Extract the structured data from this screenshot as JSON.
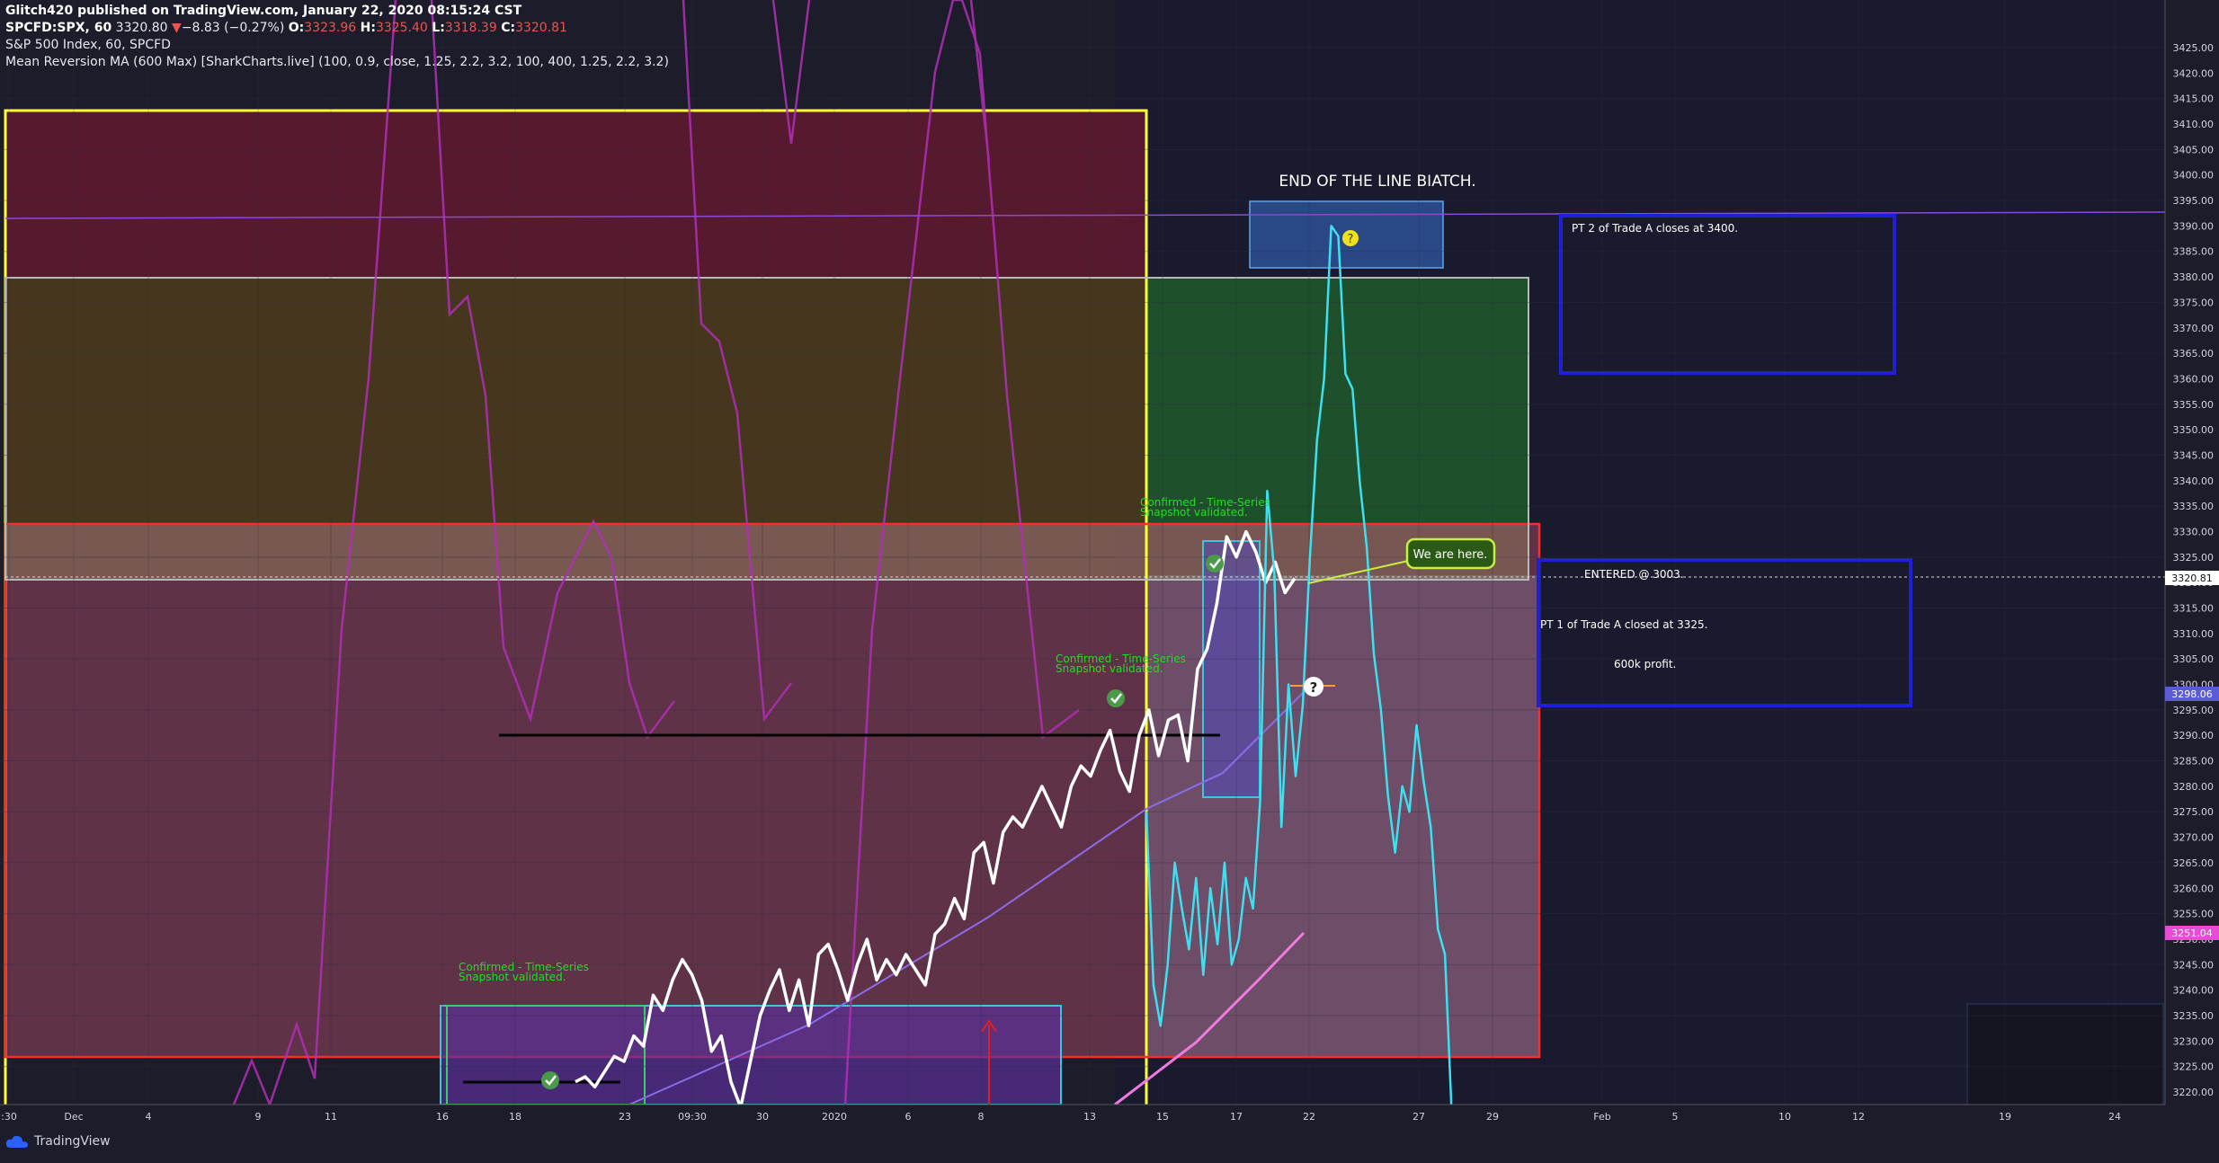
{
  "header": {
    "publisher_line": "Glitch420 published on TradingView.com, January 22, 2020 08:15:24 CST",
    "symbol": "SPCFD:SPX, 60",
    "last_price": "3320.80",
    "change_arrow": "▼",
    "change": "−8.83 (−0.27%)",
    "open_label": "O:",
    "open": "3323.96",
    "high_label": "H:",
    "high": "3325.40",
    "low_label": "L:",
    "low": "3318.39",
    "close_label": "C:",
    "close": "3320.81",
    "instrument": "S&P 500 Index, 60, SPCFD",
    "indicator": "Mean Reversion MA (600 Max) [SharkCharts.live] (100, 0.9, close, 1.25, 2.2, 3.2, 100, 400, 1.25, 2.2, 3.2)"
  },
  "footer": {
    "brand": "TradingView"
  },
  "annotations": {
    "end_of_line": "END OF THE LINE BIATCH.",
    "pt2": "PT 2 of Trade A closes at 3400.",
    "entered": "ENTERED @ 3003.",
    "pt1": "PT 1 of Trade A closed at 3325.",
    "profit": "600k profit.",
    "we_are_here": "We are here.",
    "confirmed_line1": "Confirmed - Time-Series",
    "confirmed_line2": "Snapshot validated.",
    "question_mark": "?"
  },
  "price_badges": {
    "current": "3320.81",
    "ma_upper": "3298.06",
    "ma_lower": "3251.04"
  },
  "colors": {
    "background": "#1c1c2a",
    "price_line": "#ffffff",
    "projection_line": "#3ee0f0",
    "oscillator": "#b02fb6",
    "mean_line_upper": "#8c6ce6",
    "mean_line_lower": "#f07adf",
    "yellow_box": "#ffff33",
    "red_box": "#ff2b2b",
    "green_box": "#2e7d32",
    "blue_note_border": "#1f1fd6",
    "confirmed_text": "#22dd22",
    "badge_current": "#ffffff",
    "badge_ma_upper": "#5b5bd6",
    "badge_ma_lower": "#e84bd6"
  },
  "chart_data": {
    "type": "line",
    "ylim": [
      3216,
      3427
    ],
    "x_tick_labels": [
      ":30",
      "Dec",
      "4",
      "9",
      "11",
      "16",
      "18",
      "23",
      "09:30",
      "30",
      "2020",
      "6",
      "8",
      "13",
      "15",
      "17",
      "22",
      "27",
      "29",
      "Feb",
      "5",
      "10",
      "12",
      "19",
      "24"
    ],
    "y_tick_labels": [
      "3425.00",
      "3420.00",
      "3415.00",
      "3410.00",
      "3405.00",
      "3400.00",
      "3395.00",
      "3390.00",
      "3385.00",
      "3380.00",
      "3375.00",
      "3370.00",
      "3365.00",
      "3360.00",
      "3355.00",
      "3350.00",
      "3345.00",
      "3340.00",
      "3335.00",
      "3330.00",
      "3325.00",
      "3320.00",
      "3315.00",
      "3310.00",
      "3305.00",
      "3300.00",
      "3295.00",
      "3290.00",
      "3285.00",
      "3280.00",
      "3275.00",
      "3270.00",
      "3265.00",
      "3260.00",
      "3255.00",
      "3250.00",
      "3245.00",
      "3240.00",
      "3235.00",
      "3230.00",
      "3225.00",
      "3220.00"
    ],
    "series": [
      {
        "values": [
          3222,
          3223,
          3221,
          3224,
          3227,
          3226,
          3231,
          3229,
          3239,
          3236,
          3242,
          3246,
          3243,
          3238,
          3228,
          3231,
          3222,
          3217,
          3226,
          3235,
          3240,
          3244,
          3236,
          3242,
          3233,
          3247,
          3249,
          3244,
          3238,
          3245,
          3250,
          3242,
          3246,
          3243,
          3247,
          3244,
          3241,
          3251,
          3253,
          3258,
          3254,
          3267,
          3269,
          3261,
          3271,
          3274,
          3272,
          3276,
          3280,
          3276,
          3272,
          3280,
          3284,
          3282,
          3287,
          3291,
          3283,
          3279,
          3290,
          3295,
          3286,
          3293,
          3294,
          3285,
          3303,
          3307,
          3316,
          3329,
          3325,
          3330,
          3326,
          3320,
          3324,
          3318,
          3320.8
        ]
      },
      {
        "values": [
          3275,
          3241,
          3233,
          3245,
          3265,
          3256,
          3248,
          3262,
          3243,
          3260,
          3249,
          3265,
          3245,
          3250,
          3262,
          3256,
          3277,
          3338,
          3322,
          3272,
          3300,
          3282,
          3296,
          3325,
          3348,
          3360,
          3390,
          3388,
          3361,
          3358,
          3340,
          3327,
          3306,
          3295,
          3278,
          3267,
          3280,
          3275,
          3292,
          3281,
          3272,
          3252,
          3247,
          3214
        ]
      }
    ]
  }
}
